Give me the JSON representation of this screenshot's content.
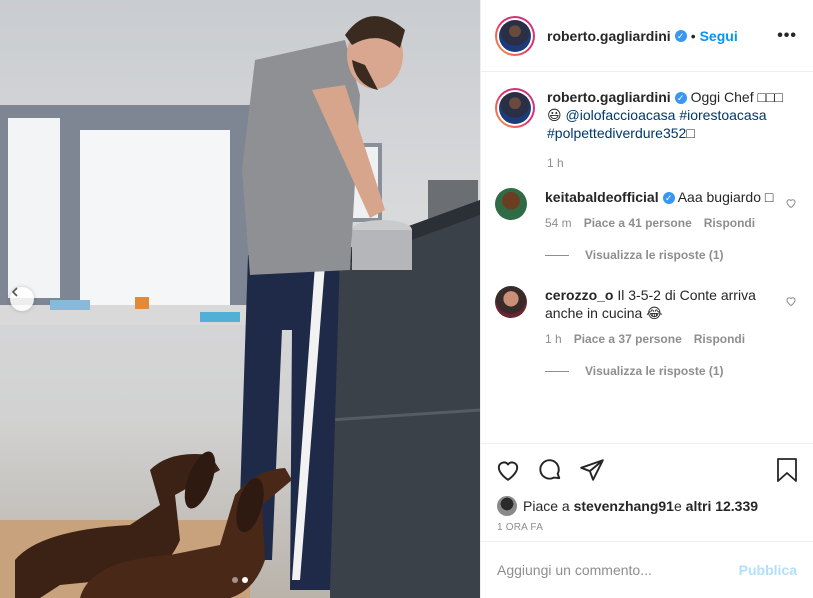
{
  "post": {
    "author": "roberto.gagliardini",
    "follow_label": "Segui",
    "separator": "•",
    "more_label": "•••",
    "verified_mark": "✓"
  },
  "caption": {
    "username": "roberto.gagliardini",
    "text_before": " Oggi Chef ",
    "emoji_run": "□□□",
    "emoji_smile": "😃",
    "mention": "@iolofaccioacasa",
    "tags": "#iorestoacasa #polpettediverdure352",
    "trailing": "□",
    "time": "1 h"
  },
  "comments": [
    {
      "username": "keitabaldeofficial",
      "verified": true,
      "text": " Aaa bugiardo □",
      "time": "54 m",
      "likes": "Piace a 41 persone",
      "reply": "Rispondi",
      "view_replies": "Visualizza le risposte (1)"
    },
    {
      "username": "cerozzo_o",
      "verified": false,
      "text": " Il 3-5-2 di Conte arriva anche in cucina 😂",
      "time": "1 h",
      "likes": "Piace a 37 persone",
      "reply": "Rispondi",
      "view_replies": "Visualizza le risposte (1)"
    }
  ],
  "likes_line": {
    "prefix": "Piace a ",
    "user": "stevenzhang91",
    "middle": " e ",
    "others": "altri 12.339"
  },
  "timestamp": "1 ORA FA",
  "add_comment": {
    "placeholder": "Aggiungi un commento...",
    "publish": "Pubblica"
  },
  "carousel": {
    "total": 2,
    "active": 2
  },
  "icons": [
    "chevron-left-icon",
    "heart-icon",
    "comment-icon",
    "share-icon",
    "bookmark-icon",
    "verified-icon"
  ],
  "colors": {
    "link": "#0095f6",
    "verified": "#3897f0",
    "muted": "#8e8e8e",
    "publish_disabled": "#b2dffc"
  }
}
